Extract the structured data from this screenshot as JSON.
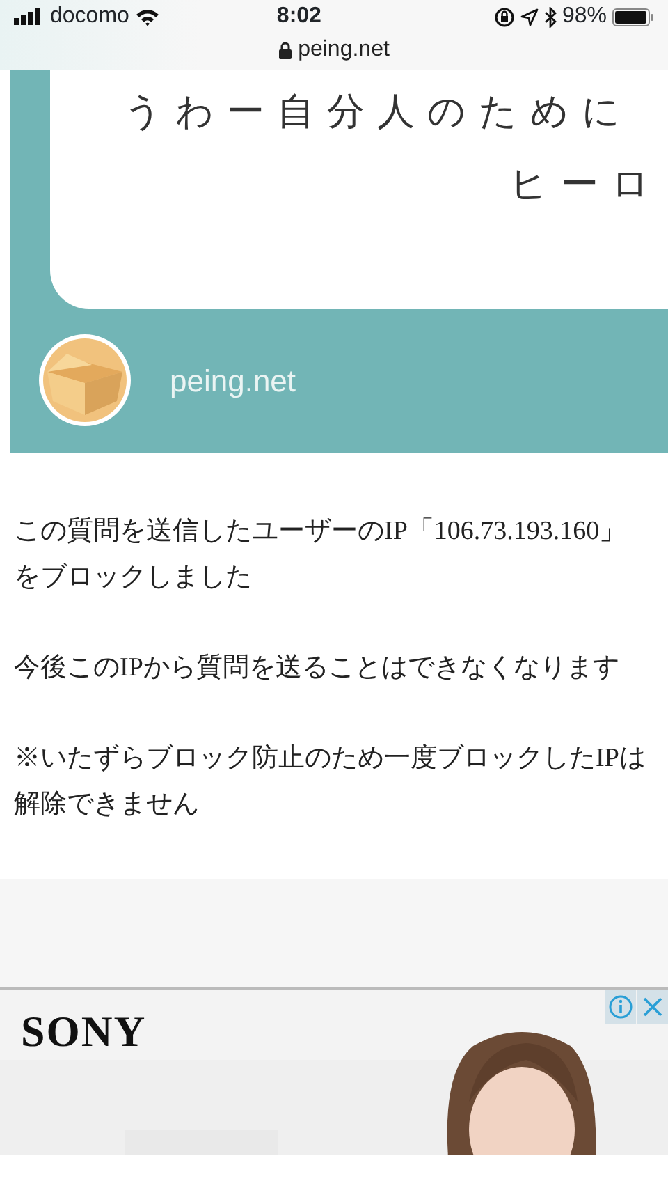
{
  "status_bar": {
    "carrier": "docomo",
    "time": "8:02",
    "battery": "98%"
  },
  "address_bar": {
    "url": "peing.net"
  },
  "shared_card": {
    "question_lines": [
      "うわー自分人のために",
      "ヒーロ"
    ],
    "site": "peing.net"
  },
  "message": {
    "paragraphs": [
      "この質問を送信したユーザーのIP「106.73.193.160」をブロックしました",
      "今後このIPから質問を送ることはできなくなります",
      "※いたずらブロック防止のため一度ブロックしたIPは解除できません"
    ]
  },
  "ad": {
    "brand": "SONY"
  }
}
